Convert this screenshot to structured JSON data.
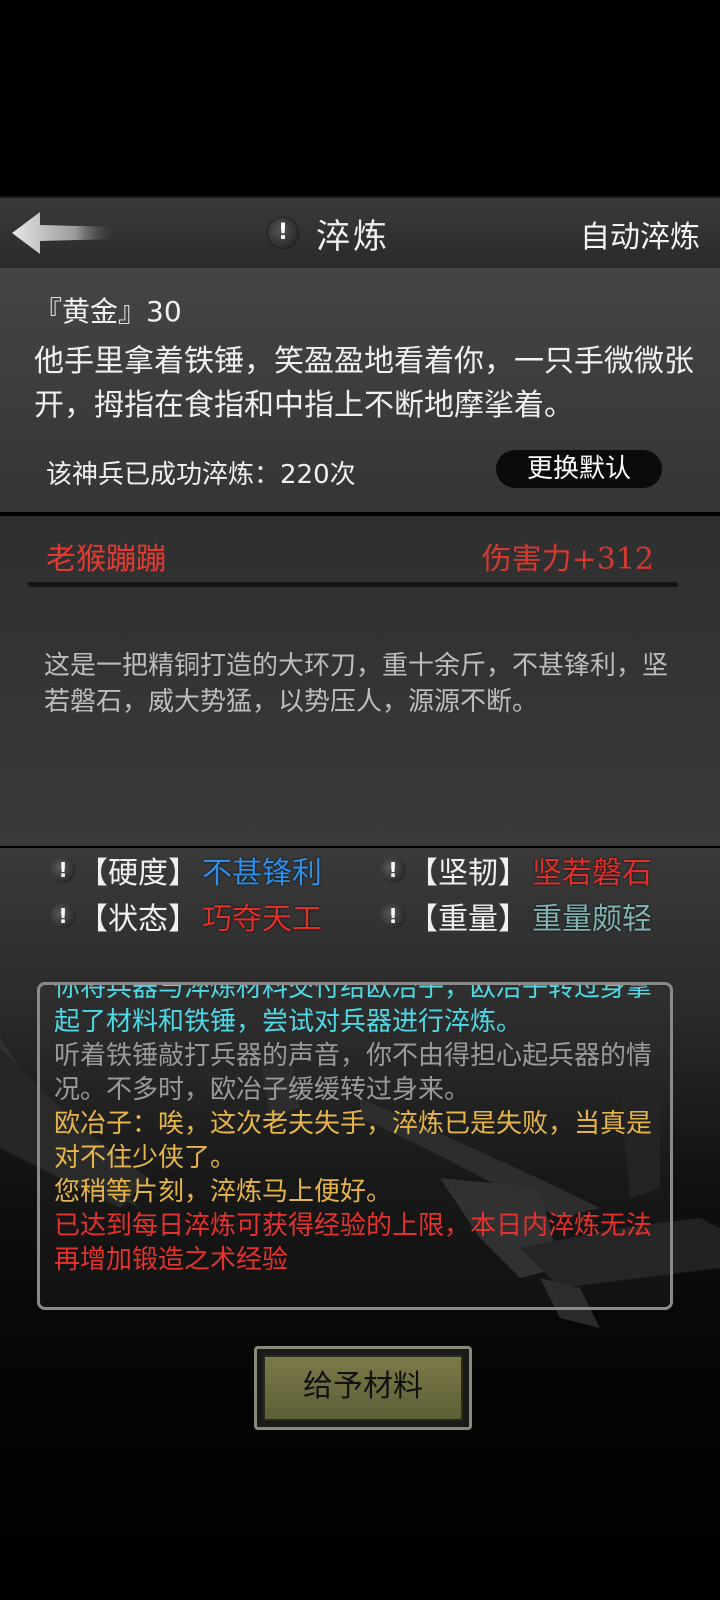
{
  "header": {
    "title": "淬炼",
    "auto_label": "自动淬炼",
    "info_glyph": "!"
  },
  "npc": {
    "gold_line": "『黄金』30",
    "speech": "他手里拿着铁锤，笑盈盈地看着你，一只手微微张开，拇指在食指和中指上不断地摩挲着。",
    "refine_count": "该神兵已成功淬炼：220次",
    "default_button": "更换默认"
  },
  "weapon": {
    "name": "老猴蹦蹦",
    "damage": "伤害力+312",
    "description": "这是一把精铜打造的大环刀，重十余斤，不甚锋利，坚若磐石，威大势猛，以势压人，源源不断。"
  },
  "stats": [
    {
      "key": "【硬度】",
      "value": "不甚锋利",
      "color": "#2f8ee8"
    },
    {
      "key": "【坚韧】",
      "value": "坚若磐石",
      "color": "#e0302a"
    },
    {
      "key": "【状态】",
      "value": "巧夺天工",
      "color": "#e0302a"
    },
    {
      "key": "【重量】",
      "value": "重量颇轻",
      "color": "#7fb3b3"
    }
  ],
  "log": [
    {
      "text": "你将兵器与淬炼材料交付给欧冶子，欧冶子转过身拿起了材料和铁锤，尝试对兵器进行淬炼。",
      "color": "#4fd8e6"
    },
    {
      "text": "听着铁锤敲打兵器的声音，你不由得担心起兵器的情况。不多时，欧冶子缓缓转过身来。",
      "color": "#9a9a9a"
    },
    {
      "text": "欧冶子：唉，这次老夫失手，淬炼已是失败，当真是对不住少侠了。",
      "color": "#e6b54a"
    },
    {
      "text": "您稍等片刻，淬炼马上便好。",
      "color": "#e6b54a"
    },
    {
      "text": "已达到每日淬炼可获得经验的上限，本日内淬炼无法再增加锻造之术经验",
      "color": "#e4322c"
    }
  ],
  "action": {
    "give_label": "给予材料"
  }
}
